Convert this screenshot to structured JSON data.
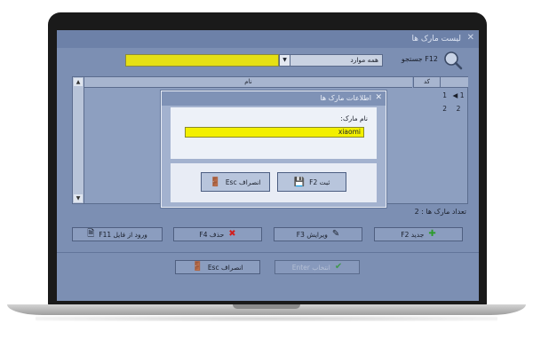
{
  "window": {
    "title": "لیست مارک ها",
    "close_icon": "x-icon"
  },
  "search": {
    "label": "جستجو F12",
    "filter_value": "همه موارد",
    "query": ""
  },
  "table": {
    "columns": [
      "کد",
      "نام"
    ],
    "rows": [
      {
        "indicator": "1",
        "code": "1",
        "name": ""
      },
      {
        "indicator": "2",
        "code": "2",
        "name": ""
      }
    ]
  },
  "status": {
    "count_text": "تعداد مارک ها : 2"
  },
  "buttons": {
    "new": "جدید F2",
    "edit": "ویرایش F3",
    "delete": "حذف F4",
    "import": "ورود از فایل F11",
    "select": "انتخاب Enter",
    "cancel": "انصراف Esc"
  },
  "dialog": {
    "title": "اطلاعات مارک ها",
    "field_label": "نام مارک:",
    "field_value": "xiaomi",
    "save": "ثبت F2",
    "cancel": "انصراف Esc"
  },
  "colors": {
    "accent_yellow": "#f3f000",
    "app_bg": "#7c8fb3",
    "add_green": "#2e9b2e",
    "delete_red": "#d02020"
  }
}
